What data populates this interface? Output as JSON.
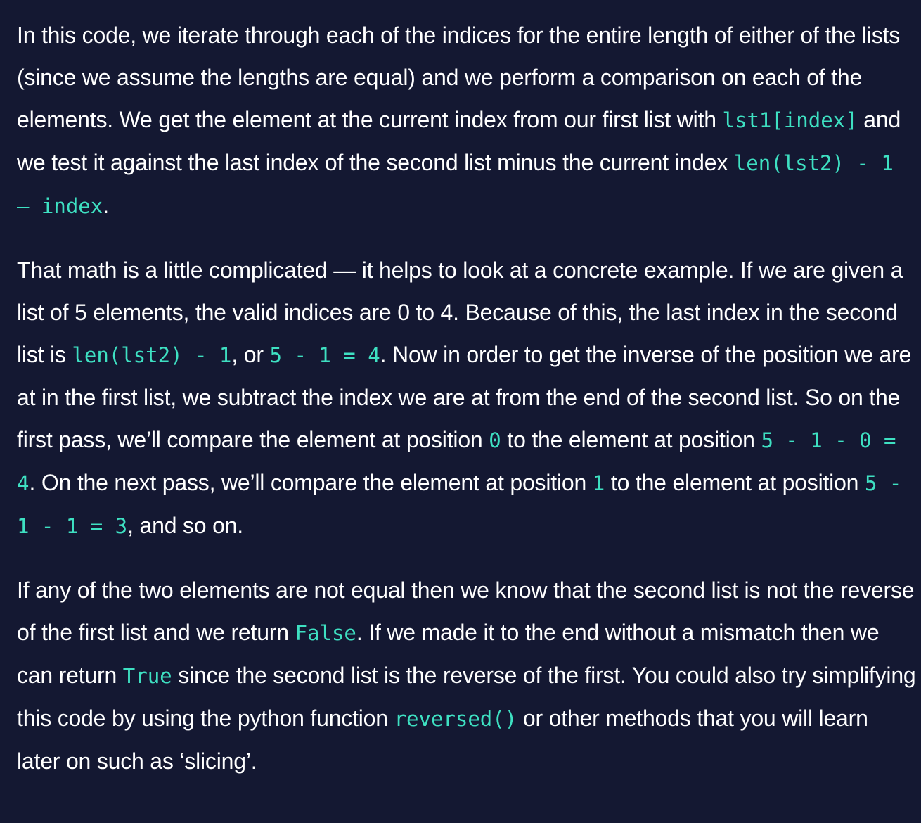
{
  "paragraphs": [
    {
      "segments": [
        {
          "text": "In this code, we iterate through each of the indices for the entire length of either of the lists (since we assume the lengths are equal) and we perform a comparison on each of the elements. We get the element at the current index from our first list with "
        },
        {
          "code": "lst1[index]"
        },
        {
          "text": " and we test it against the last index of the second list minus the current index "
        },
        {
          "code": "len(lst2) - 1 – index"
        },
        {
          "text": "."
        }
      ]
    },
    {
      "segments": [
        {
          "text": "That math is a little complicated — it helps to look at a concrete example. If we are given a list of 5 elements, the valid indices are 0 to 4. Because of this, the last index in the second list is "
        },
        {
          "code": "len(lst2) - 1"
        },
        {
          "text": ", or "
        },
        {
          "code": "5 - 1 = 4"
        },
        {
          "text": ". Now in order to get the inverse of the position we are at in the first list, we subtract the index we are at from the end of the second list. So on the first pass, we’ll compare the element at position "
        },
        {
          "code": "0"
        },
        {
          "text": " to the element at position "
        },
        {
          "code": "5 - 1 - 0 = 4"
        },
        {
          "text": ". On the next pass, we’ll compare the element at position "
        },
        {
          "code": "1"
        },
        {
          "text": " to the element at position "
        },
        {
          "code": "5 - 1 - 1 = 3"
        },
        {
          "text": ", and so on."
        }
      ]
    },
    {
      "segments": [
        {
          "text": "If any of the two elements are not equal then we know that the second list is not the reverse of the first list and we return "
        },
        {
          "code": "False"
        },
        {
          "text": ". If we made it to the end without a mismatch then we can return "
        },
        {
          "code": "True"
        },
        {
          "text": " since the second list is the reverse of the first. You could also try simplifying this code by using the python function "
        },
        {
          "code": "reversed()"
        },
        {
          "text": " or other methods that you will learn later on such as ‘slicing’."
        }
      ]
    }
  ]
}
